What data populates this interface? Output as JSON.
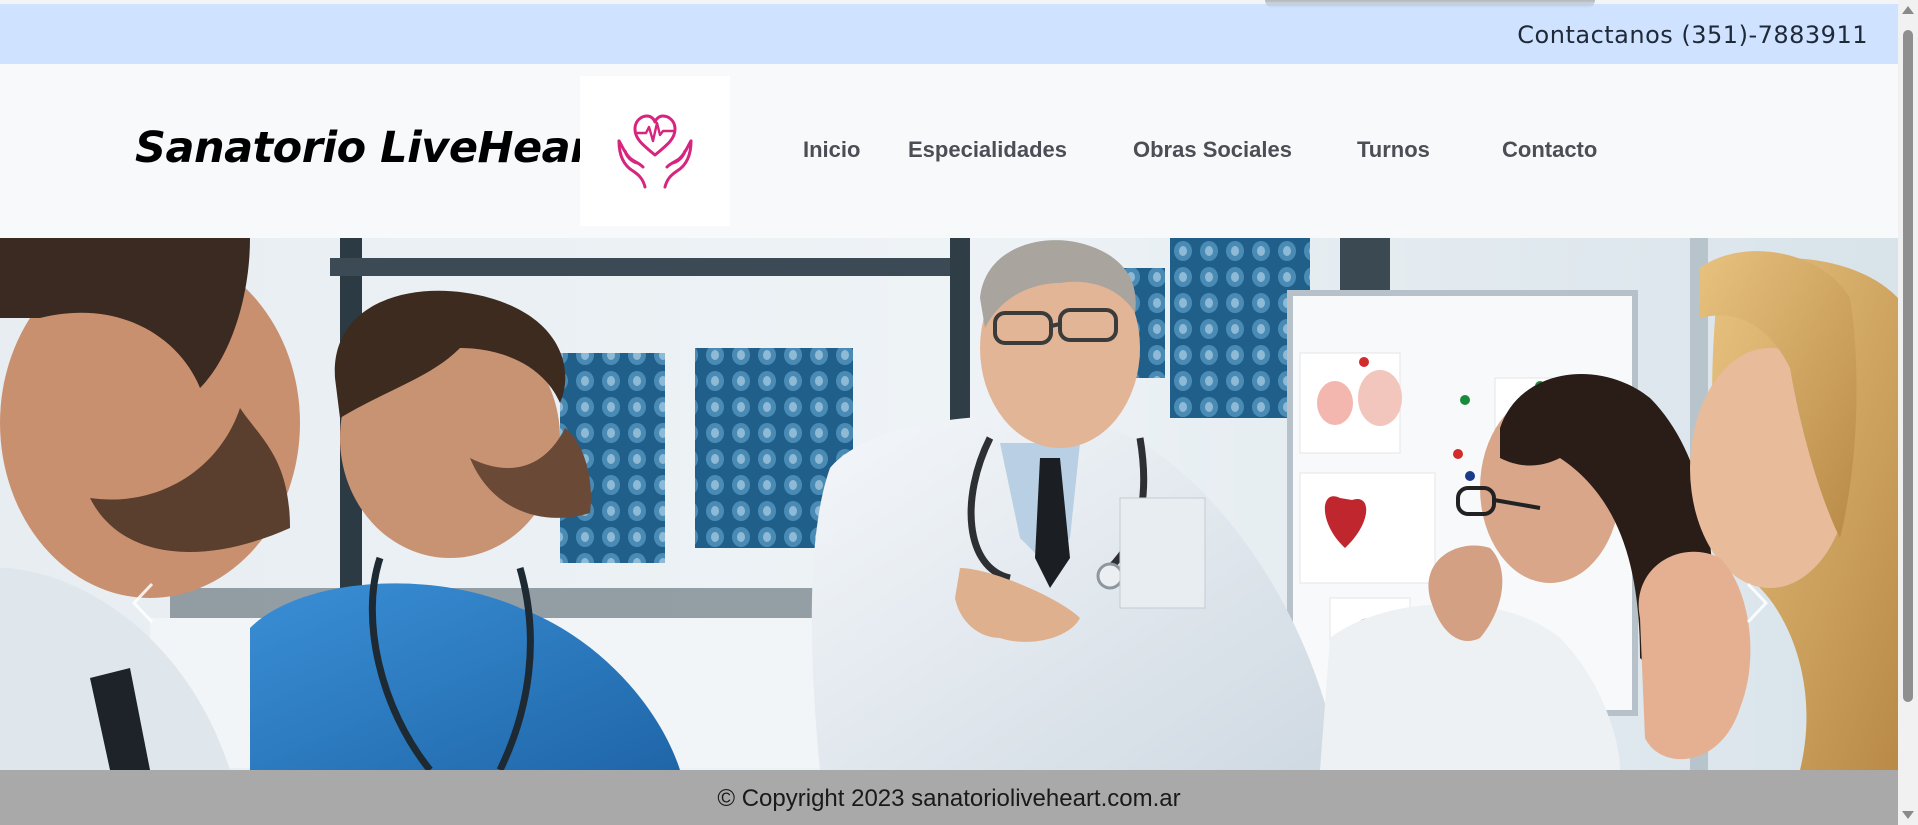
{
  "topbar": {
    "contact_text": "Contactanos (351)-7883911"
  },
  "header": {
    "brand_name": "Sanatorio LiveHeart",
    "logo_icon": "heart-hands-icon",
    "nav": [
      {
        "label": "Inicio"
      },
      {
        "label": "Especialidades"
      },
      {
        "label": "Obras Sociales"
      },
      {
        "label": "Turnos"
      },
      {
        "label": "Contacto"
      }
    ]
  },
  "hero": {
    "image": "doctors-meeting-photo",
    "prev_icon": "chevron-left-icon",
    "next_icon": "chevron-right-icon"
  },
  "footer": {
    "copyright": "© Copyright 2023 sanatorioliveheart.com.ar"
  },
  "colors": {
    "topbar_bg": "#cfe2ff",
    "header_bg": "#f8f9fb",
    "footer_bg": "#a9a9a9",
    "logo_pink": "#d6247f"
  }
}
